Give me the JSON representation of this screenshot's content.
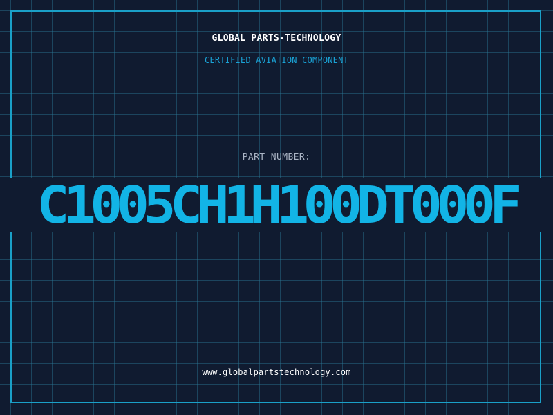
{
  "brand": {
    "company": "GLOBAL PARTS-TECHNOLOGY",
    "tagline": "CERTIFIED AVIATION COMPONENT"
  },
  "part": {
    "label": "PART NUMBER:",
    "number": "C1005CH1H100DT000F"
  },
  "footer": {
    "website": "www.globalpartstechnology.com"
  },
  "colors": {
    "background": "#101b30",
    "grid": "#2b7896",
    "accent": "#12b4e6",
    "text": "#ffffff",
    "muted": "#aab4c4"
  }
}
